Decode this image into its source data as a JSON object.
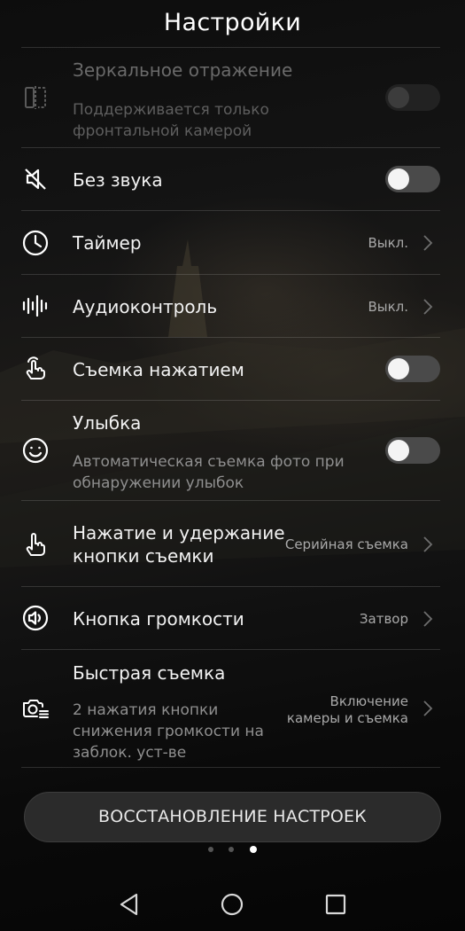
{
  "header": {
    "title": "Настройки"
  },
  "settings": {
    "mirror": {
      "label": "Зеркальное отражение",
      "description": "Поддерживается только фронтальной камерой",
      "enabled": false,
      "toggle_on": false
    },
    "mute": {
      "label": "Без звука",
      "toggle_on": false
    },
    "timer": {
      "label": "Таймер",
      "value": "Выкл."
    },
    "audio_control": {
      "label": "Аудиоконтроль",
      "value": "Выкл."
    },
    "touch_capture": {
      "label": "Съемка нажатием",
      "toggle_on": false
    },
    "smile": {
      "label": "Улыбка",
      "description": "Автоматическая съемка фото при обнаружении улыбок",
      "toggle_on": false
    },
    "hold_shutter": {
      "label": "Нажатие и удержание кнопки съемки",
      "value": "Серийная съемка"
    },
    "volume_key": {
      "label": "Кнопка громкости",
      "value": "Затвор"
    },
    "ultra_snapshot": {
      "label": "Быстрая съемка",
      "description": "2 нажатия кнопки снижения громкости на заблок. уст-ве",
      "value": "Включение камеры и съемка"
    }
  },
  "reset_button": {
    "label": "ВОССТАНОВЛЕНИЕ НАСТРОЕК"
  },
  "pager": {
    "count": 3,
    "active_index": 2
  },
  "nav": {
    "back_icon": "back-triangle-icon",
    "home_icon": "home-circle-icon",
    "recents_icon": "recents-square-icon"
  }
}
